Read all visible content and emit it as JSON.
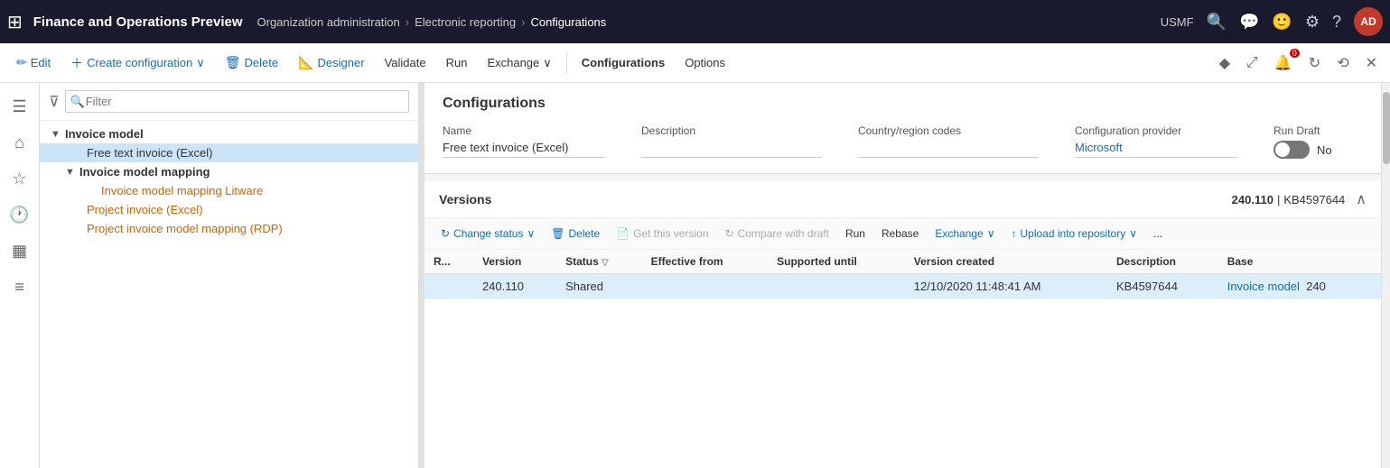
{
  "topNav": {
    "gridIcon": "⊞",
    "title": "Finance and Operations Preview",
    "breadcrumbs": [
      {
        "label": "Organization administration",
        "id": "org-admin"
      },
      {
        "label": "Electronic reporting",
        "id": "electronic-reporting"
      },
      {
        "label": "Configurations",
        "id": "configurations"
      }
    ],
    "orgLabel": "USMF",
    "searchIcon": "🔍",
    "chatIcon": "💬",
    "smileyIcon": "🙂",
    "gearIcon": "⚙",
    "helpIcon": "?",
    "avatarLabel": "AD"
  },
  "commandBar": {
    "editLabel": "Edit",
    "createConfigLabel": "Create configuration",
    "deleteLabel": "Delete",
    "designerLabel": "Designer",
    "validateLabel": "Validate",
    "runLabel": "Run",
    "exchangeLabel": "Exchange",
    "configurationsLabel": "Configurations",
    "optionsLabel": "Options",
    "searchPlaceholder": ""
  },
  "sideIcons": [
    {
      "name": "home-icon",
      "symbol": "🏠"
    },
    {
      "name": "star-icon",
      "symbol": "☆"
    },
    {
      "name": "clock-icon",
      "symbol": "🕐"
    },
    {
      "name": "calendar-icon",
      "symbol": "📅"
    },
    {
      "name": "list-icon",
      "symbol": "☰"
    }
  ],
  "leftPanel": {
    "filterPlaceholder": "Filter",
    "treeItems": [
      {
        "id": "invoice-model",
        "label": "Invoice model",
        "level": 0,
        "hasExpand": true,
        "expanded": true,
        "type": "parent"
      },
      {
        "id": "free-text-excel",
        "label": "Free text invoice (Excel)",
        "level": 1,
        "hasExpand": false,
        "expanded": false,
        "type": "selected",
        "selected": true
      },
      {
        "id": "invoice-model-mapping",
        "label": "Invoice model mapping",
        "level": 1,
        "hasExpand": true,
        "expanded": true,
        "type": "parent"
      },
      {
        "id": "invoice-model-mapping-litware",
        "label": "Invoice model mapping Litware",
        "level": 2,
        "hasExpand": false,
        "expanded": false,
        "type": "child"
      },
      {
        "id": "project-invoice-excel",
        "label": "Project invoice (Excel)",
        "level": 1,
        "hasExpand": false,
        "expanded": false,
        "type": "child"
      },
      {
        "id": "project-invoice-rdp",
        "label": "Project invoice model mapping (RDP)",
        "level": 1,
        "hasExpand": false,
        "expanded": false,
        "type": "child"
      }
    ]
  },
  "configSection": {
    "title": "Configurations",
    "fields": [
      {
        "id": "name",
        "label": "Name",
        "value": "Free text invoice (Excel)",
        "type": "text"
      },
      {
        "id": "description",
        "label": "Description",
        "value": "",
        "type": "text"
      },
      {
        "id": "country-region",
        "label": "Country/region codes",
        "value": "",
        "type": "text"
      },
      {
        "id": "config-provider",
        "label": "Configuration provider",
        "value": "Microsoft",
        "type": "link"
      }
    ],
    "runDraft": {
      "label": "Run Draft",
      "toggleValue": false,
      "noLabel": "No"
    }
  },
  "versionsSection": {
    "title": "Versions",
    "versionNumber": "240.110",
    "kbNumber": "KB4597644",
    "toolbar": {
      "changeStatus": "Change status",
      "delete": "Delete",
      "getThisVersion": "Get this version",
      "compareWithDraft": "Compare with draft",
      "run": "Run",
      "rebase": "Rebase",
      "exchange": "Exchange",
      "uploadIntoRepository": "Upload into repository",
      "moreIcon": "..."
    },
    "tableHeaders": [
      {
        "id": "row-indicator",
        "label": "R..."
      },
      {
        "id": "version",
        "label": "Version"
      },
      {
        "id": "status",
        "label": "Status",
        "hasFilter": true
      },
      {
        "id": "effective-from",
        "label": "Effective from"
      },
      {
        "id": "supported-until",
        "label": "Supported until"
      },
      {
        "id": "version-created",
        "label": "Version created"
      },
      {
        "id": "description",
        "label": "Description"
      },
      {
        "id": "base",
        "label": "Base"
      }
    ],
    "tableRows": [
      {
        "id": "row-1",
        "selected": true,
        "rowIndicator": "",
        "version": "240.110",
        "status": "Shared",
        "effectiveFrom": "",
        "supportedUntil": "",
        "versionCreated": "12/10/2020 11:48:41 AM",
        "description": "KB4597644",
        "base": "Invoice model",
        "baseNum": "240"
      }
    ]
  }
}
